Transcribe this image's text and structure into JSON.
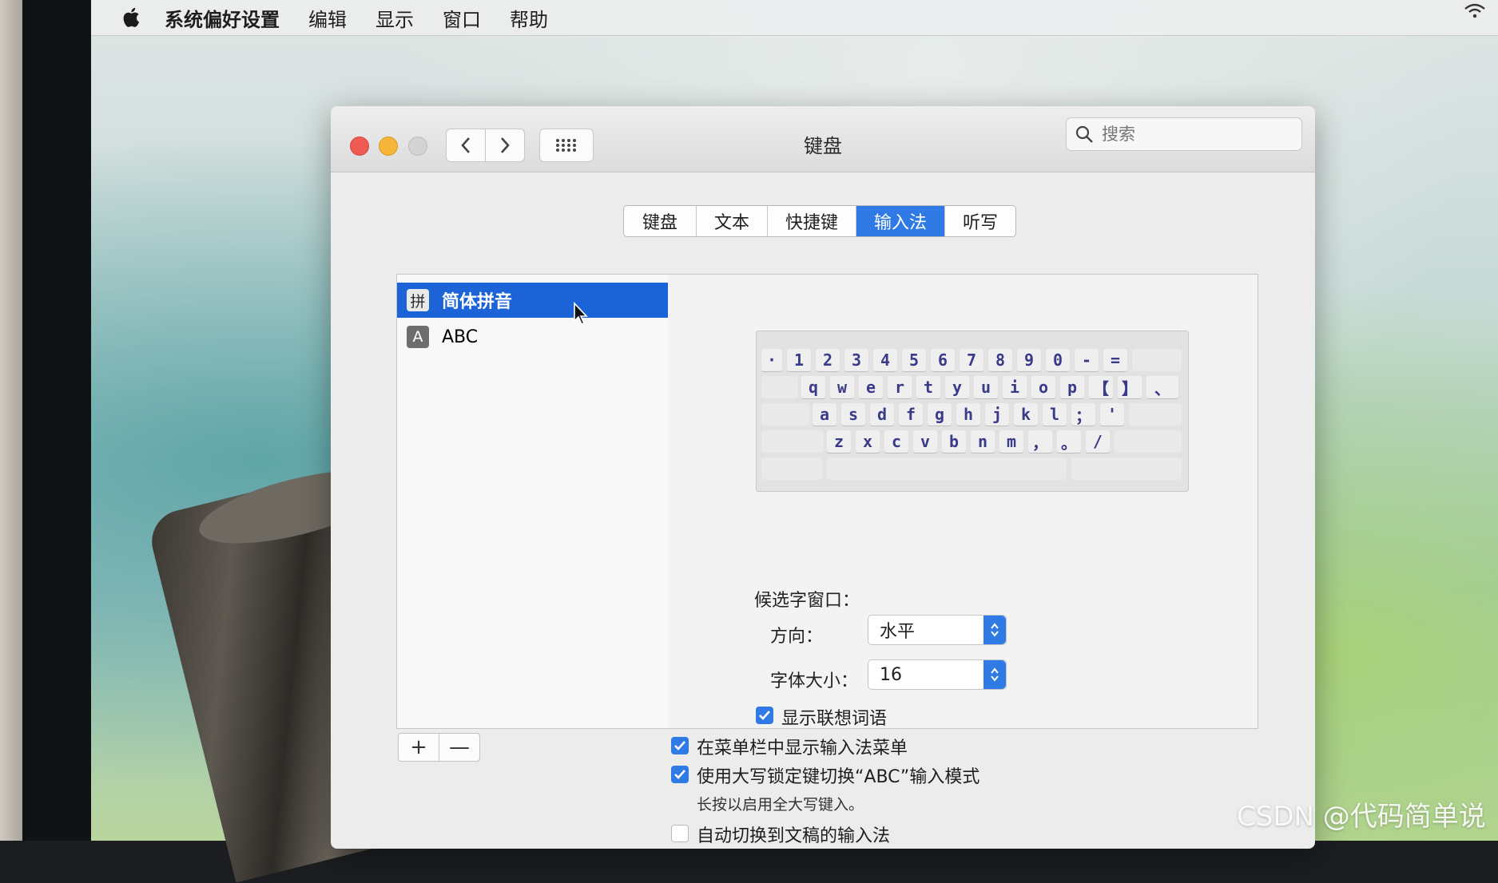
{
  "menubar": {
    "app_name": "系统偏好设置",
    "items": [
      "编辑",
      "显示",
      "窗口",
      "帮助"
    ]
  },
  "window": {
    "title": "键盘",
    "search_placeholder": "搜索"
  },
  "tabs": [
    {
      "label": "键盘",
      "active": false
    },
    {
      "label": "文本",
      "active": false
    },
    {
      "label": "快捷键",
      "active": false
    },
    {
      "label": "输入法",
      "active": true
    },
    {
      "label": "听写",
      "active": false
    }
  ],
  "input_sources": [
    {
      "badge": "拼",
      "label": "简体拼音",
      "selected": true
    },
    {
      "badge": "A",
      "label": "ABC",
      "selected": false
    }
  ],
  "keyboard": {
    "row1": [
      "·",
      "1",
      "2",
      "3",
      "4",
      "5",
      "6",
      "7",
      "8",
      "9",
      "0",
      "-",
      "="
    ],
    "row2": [
      "q",
      "w",
      "e",
      "r",
      "t",
      "y",
      "u",
      "i",
      "o",
      "p",
      "【",
      "】",
      "、"
    ],
    "row3": [
      "a",
      "s",
      "d",
      "f",
      "g",
      "h",
      "j",
      "k",
      "l",
      "；",
      "'"
    ],
    "row4": [
      "z",
      "x",
      "c",
      "v",
      "b",
      "n",
      "m",
      "，",
      "。",
      "/"
    ]
  },
  "candidate_window": {
    "heading": "候选字窗口：",
    "direction_label": "方向：",
    "direction_value": "水平",
    "font_size_label": "字体大小：",
    "font_size_value": "16",
    "show_predictions_label": "显示联想词语",
    "show_predictions_checked": true
  },
  "list_controls": {
    "add": "+",
    "remove": "—"
  },
  "options": [
    {
      "label": "在菜单栏中显示输入法菜单",
      "checked": true
    },
    {
      "label": "使用大写锁定键切换“ABC”输入模式",
      "checked": true
    },
    {
      "label": "自动切换到文稿的输入法",
      "checked": false
    }
  ],
  "caps_hint": "长按以启用全大写键入。",
  "watermark": "CSDN @代码简单说",
  "colors": {
    "accent": "#2f7ae5",
    "selection": "#1d63d8",
    "close": "#ee5b52",
    "minimize": "#f5b63a"
  }
}
